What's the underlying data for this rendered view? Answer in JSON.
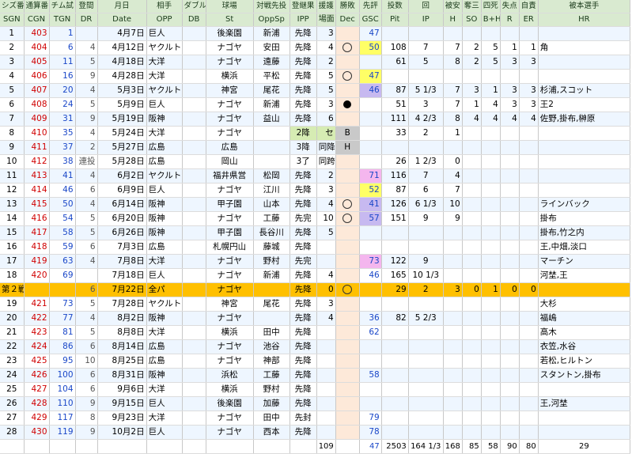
{
  "header_jp": [
    "シズ番",
    "通算番",
    "チム試",
    "登間",
    "月日",
    "相手",
    "ダブル",
    "球場",
    "対戦先投",
    "登継果",
    "援護",
    "勝敗",
    "先評",
    "投数",
    "回",
    "被安",
    "奪三",
    "四死",
    "失点",
    "自責",
    "被本選手"
  ],
  "header_en": [
    "SGN",
    "CGN",
    "TGN",
    "DR",
    "Date",
    "OPP",
    "DB",
    "St",
    "OppSp",
    "IPP",
    "場面",
    "Dec",
    "GSC",
    "Pit",
    "IP",
    "H",
    "SO",
    "B+H",
    "R",
    "ER",
    "HR"
  ],
  "rows": [
    {
      "sgn": "1",
      "cgn": "403",
      "tgn": "1",
      "dr": "",
      "date": "4月7日",
      "opp": "巨人",
      "db": "",
      "st": "後楽園",
      "oppsp": "新浦",
      "ipp": "先降",
      "ba": "3",
      "dec": "",
      "gsc": "47",
      "pit": "",
      "ip": "",
      "h": "",
      "so": "",
      "bh": "",
      "r": "",
      "er": "",
      "hr": "",
      "ipp_style": "",
      "gsc_style": ""
    },
    {
      "sgn": "2",
      "cgn": "404",
      "tgn": "6",
      "dr": "4",
      "date": "4月12日",
      "opp": "ヤクルト",
      "db": "",
      "st": "ナゴヤ",
      "oppsp": "安田",
      "ipp": "先降",
      "ba": "4",
      "dec": "win",
      "gsc": "50",
      "pit": "108",
      "ip": "7",
      "h": "7",
      "so": "2",
      "bh": "5",
      "r": "1",
      "er": "1",
      "hr": "角",
      "ipp_style": "",
      "gsc_style": "yellow"
    },
    {
      "sgn": "3",
      "cgn": "405",
      "tgn": "11",
      "dr": "5",
      "date": "4月18日",
      "opp": "大洋",
      "db": "",
      "st": "ナゴヤ",
      "oppsp": "遠藤",
      "ipp": "先降",
      "ba": "2",
      "dec": "",
      "gsc": "",
      "pit": "61",
      "ip": "5",
      "h": "8",
      "so": "2",
      "bh": "5",
      "r": "3",
      "er": "3",
      "hr": "",
      "ipp_style": "",
      "gsc_style": ""
    },
    {
      "sgn": "4",
      "cgn": "406",
      "tgn": "16",
      "dr": "9",
      "date": "4月28日",
      "opp": "大洋",
      "db": "",
      "st": "横浜",
      "oppsp": "平松",
      "ipp": "先降",
      "ba": "5",
      "dec": "win",
      "gsc": "47",
      "pit": "",
      "ip": "",
      "h": "",
      "so": "",
      "bh": "",
      "r": "",
      "er": "",
      "hr": "",
      "ipp_style": "",
      "gsc_style": "yellow"
    },
    {
      "sgn": "5",
      "cgn": "407",
      "tgn": "20",
      "dr": "4",
      "date": "5月3日",
      "opp": "ヤクルト",
      "db": "",
      "st": "神宮",
      "oppsp": "尾花",
      "ipp": "先降",
      "ba": "5",
      "dec": "",
      "gsc": "46",
      "pit": "87",
      "ip": "5 1/3",
      "h": "7",
      "so": "3",
      "bh": "1",
      "r": "3",
      "er": "3",
      "hr": "杉浦,スコット",
      "ipp_style": "",
      "gsc_style": "purple"
    },
    {
      "sgn": "6",
      "cgn": "408",
      "tgn": "24",
      "dr": "5",
      "date": "5月9日",
      "opp": "巨人",
      "db": "",
      "st": "ナゴヤ",
      "oppsp": "新浦",
      "ipp": "先降",
      "ba": "3",
      "dec": "loss",
      "gsc": "",
      "pit": "51",
      "ip": "3",
      "h": "7",
      "so": "1",
      "bh": "4",
      "r": "3",
      "er": "3",
      "hr": "王2",
      "ipp_style": "",
      "gsc_style": ""
    },
    {
      "sgn": "7",
      "cgn": "409",
      "tgn": "31",
      "dr": "9",
      "date": "5月19日",
      "opp": "阪神",
      "db": "",
      "st": "ナゴヤ",
      "oppsp": "益山",
      "ipp": "先降",
      "ba": "6",
      "dec": "",
      "gsc": "",
      "pit": "111",
      "ip": "4 2/3",
      "h": "8",
      "so": "4",
      "bh": "4",
      "r": "4",
      "er": "4",
      "hr": "佐野,掛布,榊原",
      "ipp_style": "",
      "gsc_style": ""
    },
    {
      "sgn": "8",
      "cgn": "410",
      "tgn": "35",
      "dr": "4",
      "date": "5月24日",
      "opp": "大洋",
      "db": "",
      "st": "ナゴヤ",
      "oppsp": "",
      "ipp": "2降",
      "ba": "セ",
      "dec": "B",
      "gsc": "",
      "pit": "33",
      "ip": "2",
      "h": "1",
      "so": "",
      "bh": "",
      "r": "",
      "er": "",
      "hr": "",
      "ipp_style": "g",
      "gsc_style": ""
    },
    {
      "sgn": "9",
      "cgn": "411",
      "tgn": "37",
      "dr": "2",
      "date": "5月27日",
      "opp": "広島",
      "db": "",
      "st": "広島",
      "oppsp": "",
      "ipp": "3降",
      "ba": "同降",
      "dec": "H",
      "gsc": "",
      "pit": "",
      "ip": "",
      "h": "",
      "so": "",
      "bh": "",
      "r": "",
      "er": "",
      "hr": "",
      "ipp_style": "",
      "gsc_style": ""
    },
    {
      "sgn": "10",
      "cgn": "412",
      "tgn": "38",
      "dr": "連投",
      "date": "5月28日",
      "opp": "広島",
      "db": "",
      "st": "岡山",
      "oppsp": "",
      "ipp": "3了",
      "ba": "同跨",
      "dec": "",
      "gsc": "",
      "pit": "26",
      "ip": "1 2/3",
      "h": "0",
      "so": "",
      "bh": "",
      "r": "",
      "er": "",
      "hr": "",
      "ipp_style": "",
      "gsc_style": ""
    },
    {
      "sgn": "11",
      "cgn": "413",
      "tgn": "41",
      "dr": "4",
      "date": "6月2日",
      "opp": "ヤクルト",
      "db": "",
      "st": "福井県営",
      "oppsp": "松岡",
      "ipp": "先降",
      "ba": "2",
      "dec": "",
      "gsc": "71",
      "pit": "116",
      "ip": "7",
      "h": "4",
      "so": "",
      "bh": "",
      "r": "",
      "er": "",
      "hr": "",
      "ipp_style": "",
      "gsc_style": "pink"
    },
    {
      "sgn": "12",
      "cgn": "414",
      "tgn": "46",
      "dr": "6",
      "date": "6月9日",
      "opp": "巨人",
      "db": "",
      "st": "ナゴヤ",
      "oppsp": "江川",
      "ipp": "先降",
      "ba": "3",
      "dec": "",
      "gsc": "52",
      "pit": "87",
      "ip": "6",
      "h": "7",
      "so": "",
      "bh": "",
      "r": "",
      "er": "",
      "hr": "",
      "ipp_style": "",
      "gsc_style": "yellow"
    },
    {
      "sgn": "13",
      "cgn": "415",
      "tgn": "50",
      "dr": "4",
      "date": "6月14日",
      "opp": "阪神",
      "db": "",
      "st": "甲子園",
      "oppsp": "山本",
      "ipp": "先降",
      "ba": "4",
      "dec": "win",
      "gsc": "41",
      "pit": "126",
      "ip": "6 1/3",
      "h": "10",
      "so": "",
      "bh": "",
      "r": "",
      "er": "",
      "hr": "ラインバック",
      "ipp_style": "",
      "gsc_style": "purple"
    },
    {
      "sgn": "14",
      "cgn": "416",
      "tgn": "54",
      "dr": "5",
      "date": "6月20日",
      "opp": "阪神",
      "db": "",
      "st": "ナゴヤ",
      "oppsp": "工藤",
      "ipp": "先完",
      "ba": "10",
      "dec": "win",
      "gsc": "57",
      "pit": "151",
      "ip": "9",
      "h": "9",
      "so": "",
      "bh": "",
      "r": "",
      "er": "",
      "hr": "掛布",
      "ipp_style": "",
      "gsc_style": "purple"
    },
    {
      "sgn": "15",
      "cgn": "417",
      "tgn": "58",
      "dr": "5",
      "date": "6月26日",
      "opp": "阪神",
      "db": "",
      "st": "甲子園",
      "oppsp": "長谷川",
      "ipp": "先降",
      "ba": "5",
      "dec": "",
      "gsc": "",
      "pit": "",
      "ip": "",
      "h": "",
      "so": "",
      "bh": "",
      "r": "",
      "er": "",
      "hr": "掛布,竹之内",
      "ipp_style": "",
      "gsc_style": ""
    },
    {
      "sgn": "16",
      "cgn": "418",
      "tgn": "59",
      "dr": "6",
      "date": "7月3日",
      "opp": "広島",
      "db": "",
      "st": "札幌円山",
      "oppsp": "藤城",
      "ipp": "先降",
      "ba": "",
      "dec": "",
      "gsc": "",
      "pit": "",
      "ip": "",
      "h": "",
      "so": "",
      "bh": "",
      "r": "",
      "er": "",
      "hr": "王,中畑,淡口",
      "ipp_style": "",
      "gsc_style": ""
    },
    {
      "sgn": "17",
      "cgn": "419",
      "tgn": "63",
      "dr": "4",
      "date": "7月8日",
      "opp": "大洋",
      "db": "",
      "st": "ナゴヤ",
      "oppsp": "野村",
      "ipp": "先完",
      "ba": "",
      "dec": "",
      "gsc": "73",
      "pit": "122",
      "ip": "9",
      "h": "",
      "so": "",
      "bh": "",
      "r": "",
      "er": "",
      "hr": "マーチン",
      "ipp_style": "",
      "gsc_style": "pink"
    },
    {
      "sgn": "18",
      "cgn": "420",
      "tgn": "69",
      "dr": "",
      "date": "7月18日",
      "opp": "巨人",
      "db": "",
      "st": "ナゴヤ",
      "oppsp": "新浦",
      "ipp": "先降",
      "ba": "4",
      "dec": "",
      "gsc": "46",
      "pit": "165",
      "ip": "10 1/3",
      "h": "",
      "so": "",
      "bh": "",
      "r": "",
      "er": "",
      "hr": "河埜,王",
      "ipp_style": "",
      "gsc_style": ""
    },
    {
      "sgn": "第２戦",
      "cgn": "",
      "tgn": "",
      "dr": "6",
      "date": "7月22日",
      "opp": "全パ",
      "db": "",
      "st": "ナゴヤ",
      "oppsp": "",
      "ipp": "先降",
      "ba": "0",
      "dec": "win",
      "gsc": "",
      "pit": "29",
      "ip": "2",
      "h": "3",
      "so": "0",
      "bh": "1",
      "r": "0",
      "er": "0",
      "hr": "",
      "ipp_style": "",
      "gsc_style": "",
      "special": true
    },
    {
      "sgn": "19",
      "cgn": "421",
      "tgn": "73",
      "dr": "5",
      "date": "7月28日",
      "opp": "ヤクルト",
      "db": "",
      "st": "神宮",
      "oppsp": "尾花",
      "ipp": "先降",
      "ba": "3",
      "dec": "",
      "gsc": "",
      "pit": "",
      "ip": "",
      "h": "",
      "so": "",
      "bh": "",
      "r": "",
      "er": "",
      "hr": "大杉",
      "ipp_style": "",
      "gsc_style": ""
    },
    {
      "sgn": "20",
      "cgn": "422",
      "tgn": "77",
      "dr": "4",
      "date": "8月2日",
      "opp": "阪神",
      "db": "",
      "st": "ナゴヤ",
      "oppsp": "",
      "ipp": "先降",
      "ba": "4",
      "dec": "",
      "gsc": "36",
      "pit": "82",
      "ip": "5 2/3",
      "h": "",
      "so": "",
      "bh": "",
      "r": "",
      "er": "",
      "hr": "福嶋",
      "ipp_style": "",
      "gsc_style": ""
    },
    {
      "sgn": "21",
      "cgn": "423",
      "tgn": "81",
      "dr": "5",
      "date": "8月8日",
      "opp": "大洋",
      "db": "",
      "st": "横浜",
      "oppsp": "田中",
      "ipp": "先降",
      "ba": "",
      "dec": "",
      "gsc": "62",
      "pit": "",
      "ip": "",
      "h": "",
      "so": "",
      "bh": "",
      "r": "",
      "er": "",
      "hr": "高木",
      "ipp_style": "",
      "gsc_style": ""
    },
    {
      "sgn": "22",
      "cgn": "424",
      "tgn": "86",
      "dr": "6",
      "date": "8月14日",
      "opp": "広島",
      "db": "",
      "st": "ナゴヤ",
      "oppsp": "池谷",
      "ipp": "先降",
      "ba": "",
      "dec": "",
      "gsc": "",
      "pit": "",
      "ip": "",
      "h": "",
      "so": "",
      "bh": "",
      "r": "",
      "er": "",
      "hr": "衣笠,水谷",
      "ipp_style": "",
      "gsc_style": ""
    },
    {
      "sgn": "23",
      "cgn": "425",
      "tgn": "95",
      "dr": "10",
      "date": "8月25日",
      "opp": "広島",
      "db": "",
      "st": "ナゴヤ",
      "oppsp": "神部",
      "ipp": "先降",
      "ba": "",
      "dec": "",
      "gsc": "",
      "pit": "",
      "ip": "",
      "h": "",
      "so": "",
      "bh": "",
      "r": "",
      "er": "",
      "hr": "若松,ヒルトン",
      "ipp_style": "",
      "gsc_style": ""
    },
    {
      "sgn": "24",
      "cgn": "426",
      "tgn": "100",
      "dr": "6",
      "date": "8月31日",
      "opp": "阪神",
      "db": "",
      "st": "浜松",
      "oppsp": "工藤",
      "ipp": "先降",
      "ba": "",
      "dec": "",
      "gsc": "58",
      "pit": "",
      "ip": "",
      "h": "",
      "so": "",
      "bh": "",
      "r": "",
      "er": "",
      "hr": "スタントン,掛布",
      "ipp_style": "",
      "gsc_style": ""
    },
    {
      "sgn": "25",
      "cgn": "427",
      "tgn": "104",
      "dr": "6",
      "date": "9月6日",
      "opp": "大洋",
      "db": "",
      "st": "横浜",
      "oppsp": "野村",
      "ipp": "先降",
      "ba": "",
      "dec": "",
      "gsc": "",
      "pit": "",
      "ip": "",
      "h": "",
      "so": "",
      "bh": "",
      "r": "",
      "er": "",
      "hr": "",
      "ipp_style": "",
      "gsc_style": ""
    },
    {
      "sgn": "26",
      "cgn": "428",
      "tgn": "110",
      "dr": "9",
      "date": "9月15日",
      "opp": "巨人",
      "db": "",
      "st": "後楽園",
      "oppsp": "加藤",
      "ipp": "先降",
      "ba": "",
      "dec": "",
      "gsc": "",
      "pit": "",
      "ip": "",
      "h": "",
      "so": "",
      "bh": "",
      "r": "",
      "er": "",
      "hr": "王,河埜",
      "ipp_style": "",
      "gsc_style": ""
    },
    {
      "sgn": "27",
      "cgn": "429",
      "tgn": "117",
      "dr": "8",
      "date": "9月23日",
      "opp": "大洋",
      "db": "",
      "st": "ナゴヤ",
      "oppsp": "田中",
      "ipp": "先封",
      "ba": "",
      "dec": "",
      "gsc": "79",
      "pit": "",
      "ip": "",
      "h": "",
      "so": "",
      "bh": "",
      "r": "",
      "er": "",
      "hr": "",
      "ipp_style": "",
      "gsc_style": ""
    },
    {
      "sgn": "28",
      "cgn": "430",
      "tgn": "119",
      "dr": "9",
      "date": "10月2日",
      "opp": "巨人",
      "db": "",
      "st": "ナゴヤ",
      "oppsp": "西本",
      "ipp": "先降",
      "ba": "",
      "dec": "",
      "gsc": "78",
      "pit": "",
      "ip": "",
      "h": "",
      "so": "",
      "bh": "",
      "r": "",
      "er": "",
      "hr": "",
      "ipp_style": "",
      "gsc_style": ""
    }
  ],
  "totals": {
    "ba": "109",
    "gsc": "47",
    "pit": "2503",
    "ip": "164 1/3",
    "h": "168",
    "so": "85",
    "bh": "58",
    "r": "90",
    "er": "80",
    "hr": "29"
  }
}
